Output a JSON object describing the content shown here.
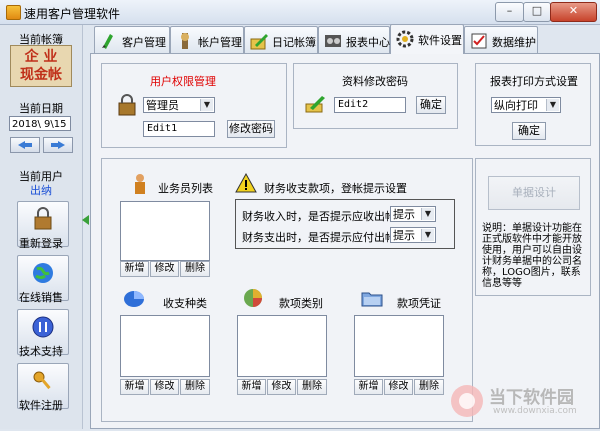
{
  "window": {
    "title": "速用客户管理软件",
    "controls": {
      "minimize": "–",
      "maximize": "□",
      "close": "✕"
    }
  },
  "sidebar": {
    "current_ledger_label": "当前帐簿",
    "logo_line1": "企 业",
    "logo_line2": "现金帐",
    "current_date_label": "当前日期",
    "date_value": "2018\\ 9\\15",
    "current_user_label": "当前用户",
    "current_user": "出纳",
    "buttons": [
      {
        "label": "重新登录",
        "icon": "lock-icon"
      },
      {
        "label": "在线销售",
        "icon": "globe-icon"
      },
      {
        "label": "技术支持",
        "icon": "support-icon"
      },
      {
        "label": "软件注册",
        "icon": "key-icon"
      }
    ]
  },
  "tabs": [
    {
      "label": "客户管理",
      "icon": "customer-icon"
    },
    {
      "label": "帐户管理",
      "icon": "account-icon"
    },
    {
      "label": "日记帐簿",
      "icon": "journal-icon"
    },
    {
      "label": "报表中心",
      "icon": "report-icon"
    },
    {
      "label": "软件设置",
      "icon": "settings-icon",
      "active": true
    },
    {
      "label": "数据维护",
      "icon": "data-icon"
    }
  ],
  "permission": {
    "title": "用户权限管理",
    "title_color": "#e00000",
    "role_select": "管理员",
    "edit_value": "Edit1",
    "change_password": "修改密码"
  },
  "profile": {
    "title": "资料修改密码",
    "edit_value": "Edit2",
    "confirm": "确定"
  },
  "print": {
    "title": "报表打印方式设置",
    "mode_select": "纵向打印",
    "confirm": "确定"
  },
  "salesmen": {
    "title": "业务员列表",
    "add": "新增",
    "edit": "修改",
    "delete": "删除"
  },
  "reminder": {
    "title": "财务收支款项，登帐提示设置",
    "income_label": "财务收入时，是否提示应收出帐？",
    "income_value": "提示",
    "expense_label": "财务支出时，是否提示应付出帐？",
    "expense_value": "提示"
  },
  "income_types": {
    "title": "收支种类",
    "add": "新增",
    "edit": "修改",
    "delete": "删除"
  },
  "payment_types": {
    "title": "款项类别",
    "add": "新增",
    "edit": "修改",
    "delete": "删除"
  },
  "vouchers": {
    "title": "款项凭证",
    "add": "新增",
    "edit": "修改",
    "delete": "删除"
  },
  "receipt": {
    "design_button": "单据设计",
    "note": "说明：单据设计功能在正式版软件中才能开放使用，用户可以自由设计财务单据中的公司名称，LOGO图片，联系信息等等"
  },
  "watermark": {
    "line1": "当下软件园",
    "line2": "www.downxia.com"
  }
}
